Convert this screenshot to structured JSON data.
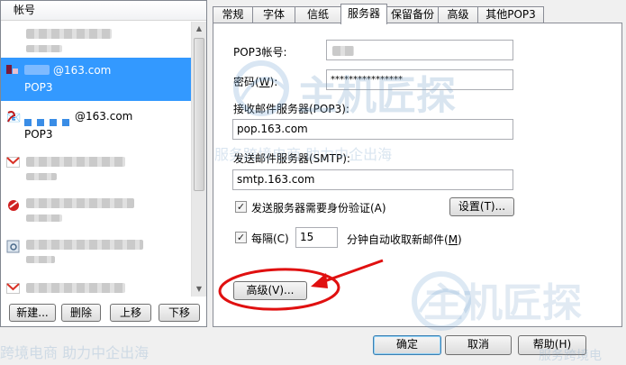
{
  "left_panel": {
    "header": "帐号",
    "accounts": [
      {
        "suffix": "",
        "type": ""
      },
      {
        "suffix": "@163.com",
        "type": "POP3"
      },
      {
        "suffix": "@163.com",
        "type": "POP3"
      },
      {
        "suffix": "",
        "type": ""
      },
      {
        "suffix": "",
        "type": ""
      },
      {
        "suffix": "",
        "type": ""
      },
      {
        "suffix": "",
        "type": ""
      }
    ],
    "buttons": {
      "new": "新建...",
      "delete": "删除",
      "move_up": "上移",
      "move_down": "下移"
    }
  },
  "tabs": [
    "常规",
    "字体",
    "信纸",
    "服务器",
    "保留备份",
    "高级",
    "其他POP3"
  ],
  "active_tab": "服务器",
  "server_tab": {
    "pop3_account_label": "POP3帐号:",
    "password_label": "密码(",
    "password_key": "W",
    "password_label_end": "):",
    "password_value": "****************",
    "incoming_label": "接收邮件服务器(POP3):",
    "incoming_value": "pop.163.com",
    "outgoing_label": "发送邮件服务器(SMTP):",
    "outgoing_value": "smtp.163.com",
    "auth_label": "发送服务器需要身份验证(A)",
    "auth_checked": true,
    "settings_button": "设置(T)...",
    "every_label": "每隔(C)",
    "every_checked": true,
    "interval_value": "15",
    "interval_suffix": "分钟自动收取新邮件(",
    "interval_key": "M",
    "interval_suffix_end": ")",
    "advanced_button": "高级(V)..."
  },
  "dialog_buttons": {
    "ok": "确定",
    "cancel": "取消",
    "help": "帮助(H)"
  },
  "watermark": {
    "brand": "主机匠探",
    "slogan": "服务跨境电商 助力中企出海",
    "slogan2": "跨境电商 助力中企出海",
    "slogan3": "服务跨境电"
  },
  "colors": {
    "selection": "#3399ff",
    "annotation": "#e01010"
  }
}
